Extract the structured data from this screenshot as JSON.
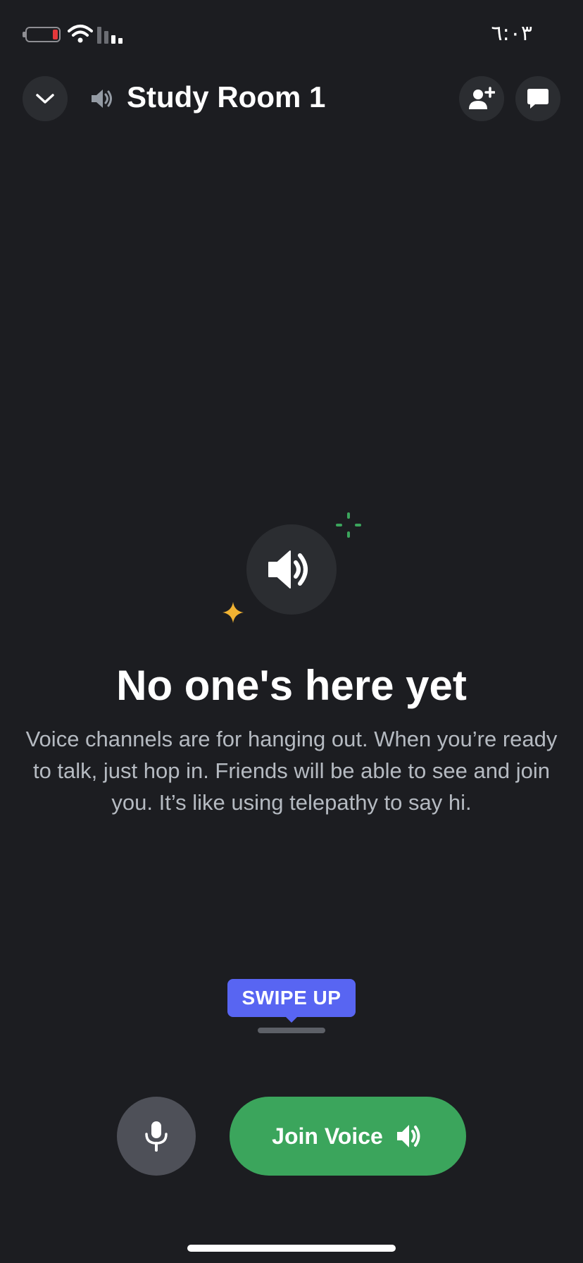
{
  "status_bar": {
    "time": "٦:٠٣"
  },
  "header": {
    "channel_title": "Study Room 1"
  },
  "empty_state": {
    "heading": "No one's here yet",
    "description": "Voice channels are for hanging out. When you’re ready to talk, just hop in. Friends will be able to see and join you. It’s like using telepathy to say hi."
  },
  "swipe_hint": {
    "label": "SWIPE UP"
  },
  "actions": {
    "join_label": "Join Voice"
  },
  "colors": {
    "background": "#1c1d21",
    "accent_blurple": "#5865f2",
    "join_green": "#3ba55c",
    "sparkle_green": "#3ba55c",
    "sparkle_yellow": "#f0b232"
  }
}
